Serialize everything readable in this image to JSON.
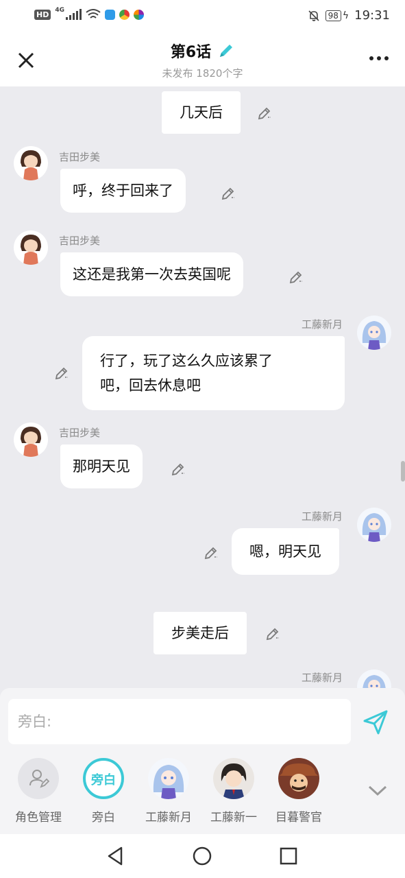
{
  "status": {
    "net": "4G",
    "battery": "98",
    "time": "19:31"
  },
  "header": {
    "title": "第6话",
    "subtitle": "未发布 1820个字"
  },
  "chat": {
    "narration_1": "几天后",
    "msg1": {
      "name": "吉田步美",
      "text": "呼，终于回来了"
    },
    "msg2": {
      "name": "吉田步美",
      "text": "这还是我第一次去英国呢"
    },
    "msg3": {
      "name": "工藤新月",
      "line1": "行了，玩了这么久应该累了",
      "line2": "吧，回去休息吧"
    },
    "msg4": {
      "name": "吉田步美",
      "text": "那明天见"
    },
    "msg5": {
      "name": "工藤新月",
      "text": "嗯，明天见"
    },
    "narration_2": "步美走后",
    "msg6": {
      "name": "工藤新月"
    }
  },
  "input": {
    "placeholder": "旁白:"
  },
  "roles": [
    {
      "label": "角色管理",
      "icon": "role-manage-icon"
    },
    {
      "label": "旁白",
      "badge": "旁白"
    },
    {
      "label": "工藤新月"
    },
    {
      "label": "工藤新一"
    },
    {
      "label": "目暮警官"
    }
  ],
  "colors": {
    "accent": "#3cc9d6",
    "edit_icon": "#7a7a7a"
  }
}
